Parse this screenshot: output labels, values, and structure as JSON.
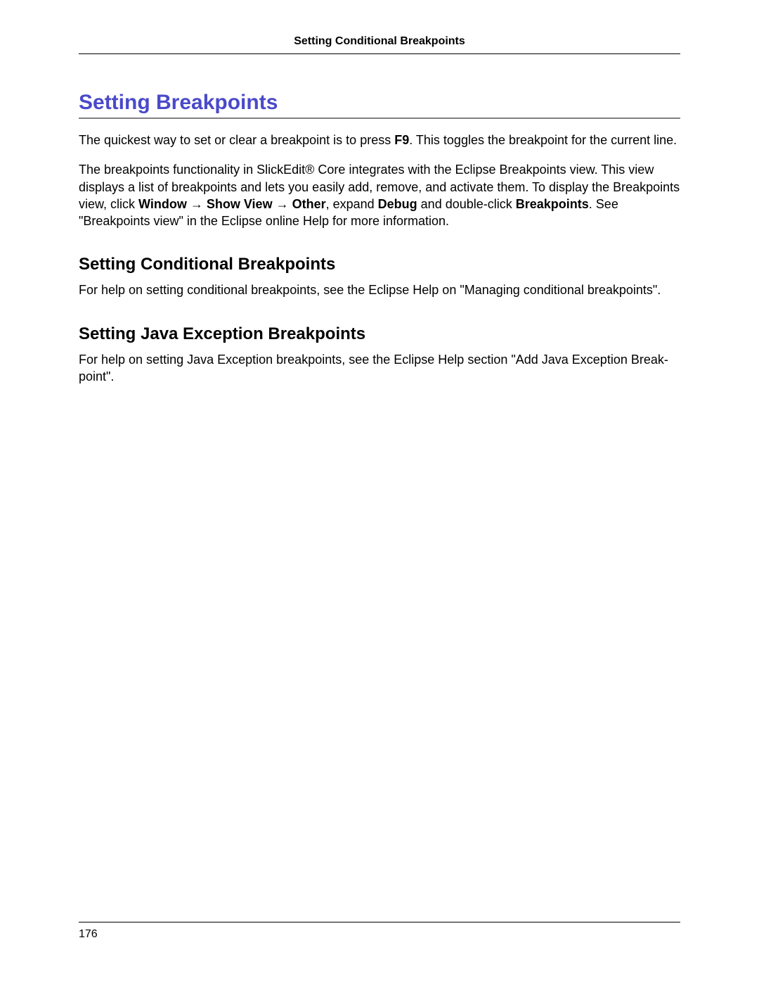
{
  "header": {
    "running_title": "Setting Conditional Breakpoints"
  },
  "title": "Setting Breakpoints",
  "paragraphs": {
    "p1_pre": "The quickest way to set or clear a breakpoint is to press ",
    "p1_key": "F9",
    "p1_post": ". This toggles the breakpoint for the current line.",
    "p2_pre": "The breakpoints functionality in SlickEdit® Core integrates with the Eclipse Breakpoints view. This view displays a list of breakpoints and lets you easily add, remove, and activate them. To display the Break­points view, click ",
    "p2_b1": "Window",
    "p2_arrow1": " → ",
    "p2_b2": "Show View",
    "p2_arrow2": " → ",
    "p2_b3": "Other",
    "p2_mid1": ", expand ",
    "p2_b4": "Debug",
    "p2_mid2": " and double-click ",
    "p2_b5": "Breakpoints",
    "p2_post": ". See \"Breakpoints view\" in the Eclipse online Help for more information."
  },
  "sections": {
    "conditional": {
      "heading": "Setting Conditional Breakpoints",
      "body": "For help on setting conditional breakpoints, see the Eclipse Help on \"Managing conditional breakpoints\"."
    },
    "java_exception": {
      "heading": "Setting Java Exception Breakpoints",
      "body": "For help on setting Java Exception breakpoints, see the Eclipse Help section \"Add Java Exception Break­point\"."
    }
  },
  "footer": {
    "page_number": "176"
  }
}
